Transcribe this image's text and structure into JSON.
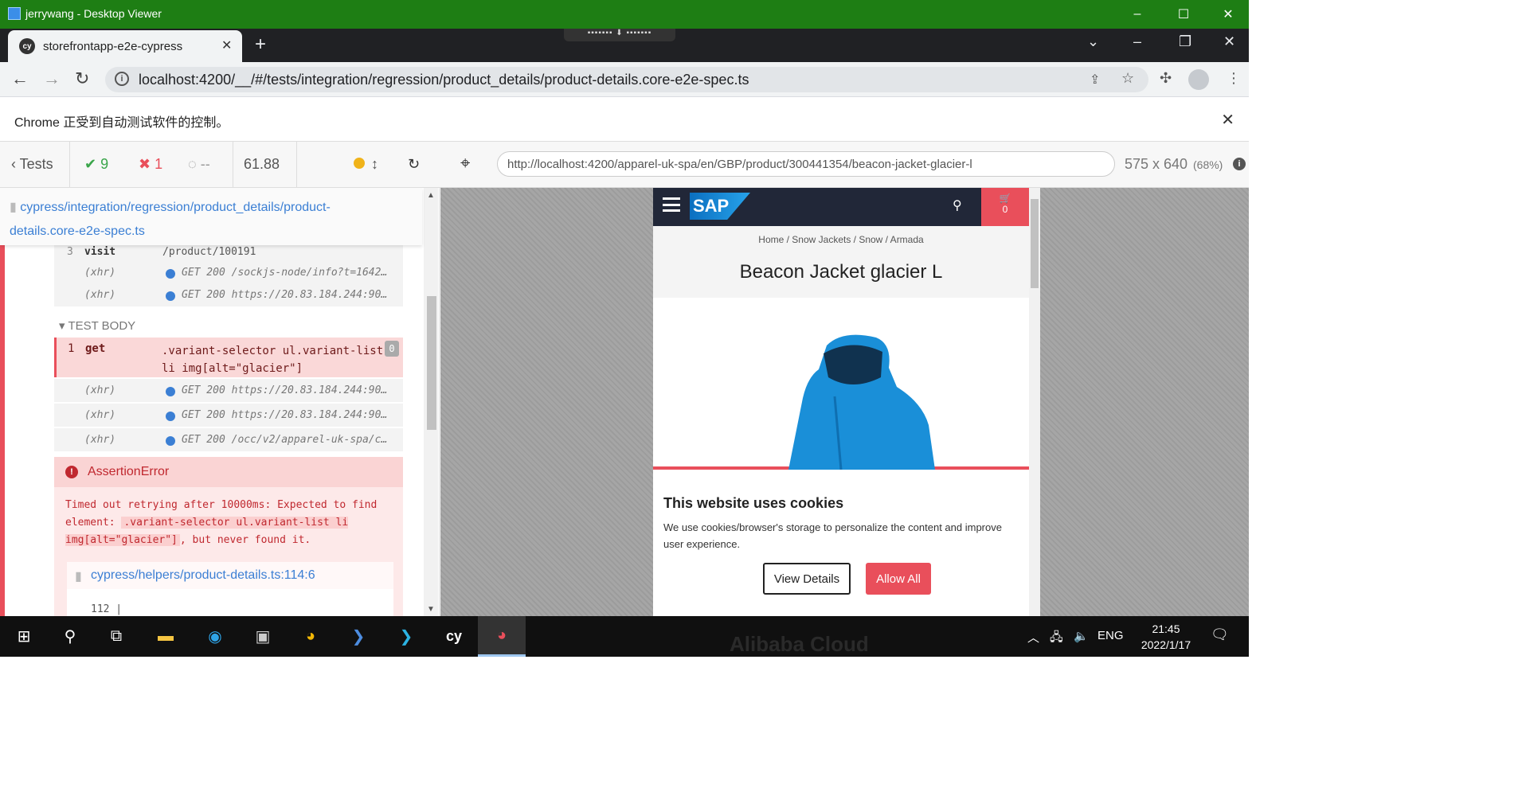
{
  "rdp_window": {
    "title": "jerrywang - Desktop Viewer",
    "minimize_glyph": "–",
    "maximize_glyph": "☐",
    "close_glyph": "✕"
  },
  "browser": {
    "tab_title": "storefrontapp-e2e-cypress",
    "tab_icon_text": "cy",
    "tab_close": "✕",
    "new_tab": "+",
    "address": "localhost:4200/__/#/tests/integration/regression/product_details/product-details.core-e2e-spec.ts",
    "automation_banner": "Chrome 正受到自动测试软件的控制。"
  },
  "cypress": {
    "tests_label": "Tests",
    "passed": "9",
    "failed": "1",
    "pending": "--",
    "duration": "61.88",
    "spec_path": "cypress/integration/regression/product_details/product-details.core-e2e-spec.ts",
    "aut_url": "http://localhost:4200/apparel-uk-spa/en/GBP/product/300441354/beacon-jacket-glacier-l",
    "viewport": "575 x 640",
    "scale": "(68%)",
    "commands_before": [
      {
        "n": "3",
        "name": "visit",
        "msg": "/product/100191"
      },
      {
        "n": "",
        "name": "(xhr)",
        "msg": "GET 200 /sockjs-node/info?t=1642…"
      },
      {
        "n": "",
        "name": "(xhr)",
        "msg": "GET 200 https://20.83.184.244:90…"
      }
    ],
    "section_label": "TEST BODY",
    "get_command": {
      "n": "1",
      "name": "get",
      "selector": ".variant-selector ul.variant-list li img[alt=\"glacier\"]",
      "count": "0"
    },
    "commands_after": [
      {
        "n": "",
        "name": "(xhr)",
        "msg": "GET 200 https://20.83.184.244:90…"
      },
      {
        "n": "",
        "name": "(xhr)",
        "msg": "GET 200 https://20.83.184.244:90…"
      },
      {
        "n": "",
        "name": "(xhr)",
        "msg": "GET 200 /occ/v2/apparel-uk-spa/c…"
      }
    ],
    "error": {
      "title": "AssertionError",
      "message_before": "Timed out retrying after 10000ms: Expected to find element: ",
      "code": ".variant-selector ul.variant-list li img[alt=\"glacier\"]",
      "message_after": ", but never found it.",
      "file": "cypress/helpers/product-details.ts:114:6",
      "line": "112 |"
    }
  },
  "storefront": {
    "logo": "SAP",
    "cart_count": "0",
    "breadcrumb": "Home / Snow Jackets / Snow / Armada",
    "product_title": "Beacon Jacket glacier L",
    "cookie_title": "This website uses cookies",
    "cookie_text": "We use cookies/browser's storage to personalize the content and improve user experience.",
    "view_details": "View Details",
    "allow_all": "Allow All",
    "jacket_color": "#1a8fd8"
  },
  "taskbar": {
    "lang": "ENG",
    "time": "21:45",
    "date": "2022/1/17",
    "cy_label": "cy",
    "watermark": "Alibaba Cloud"
  }
}
